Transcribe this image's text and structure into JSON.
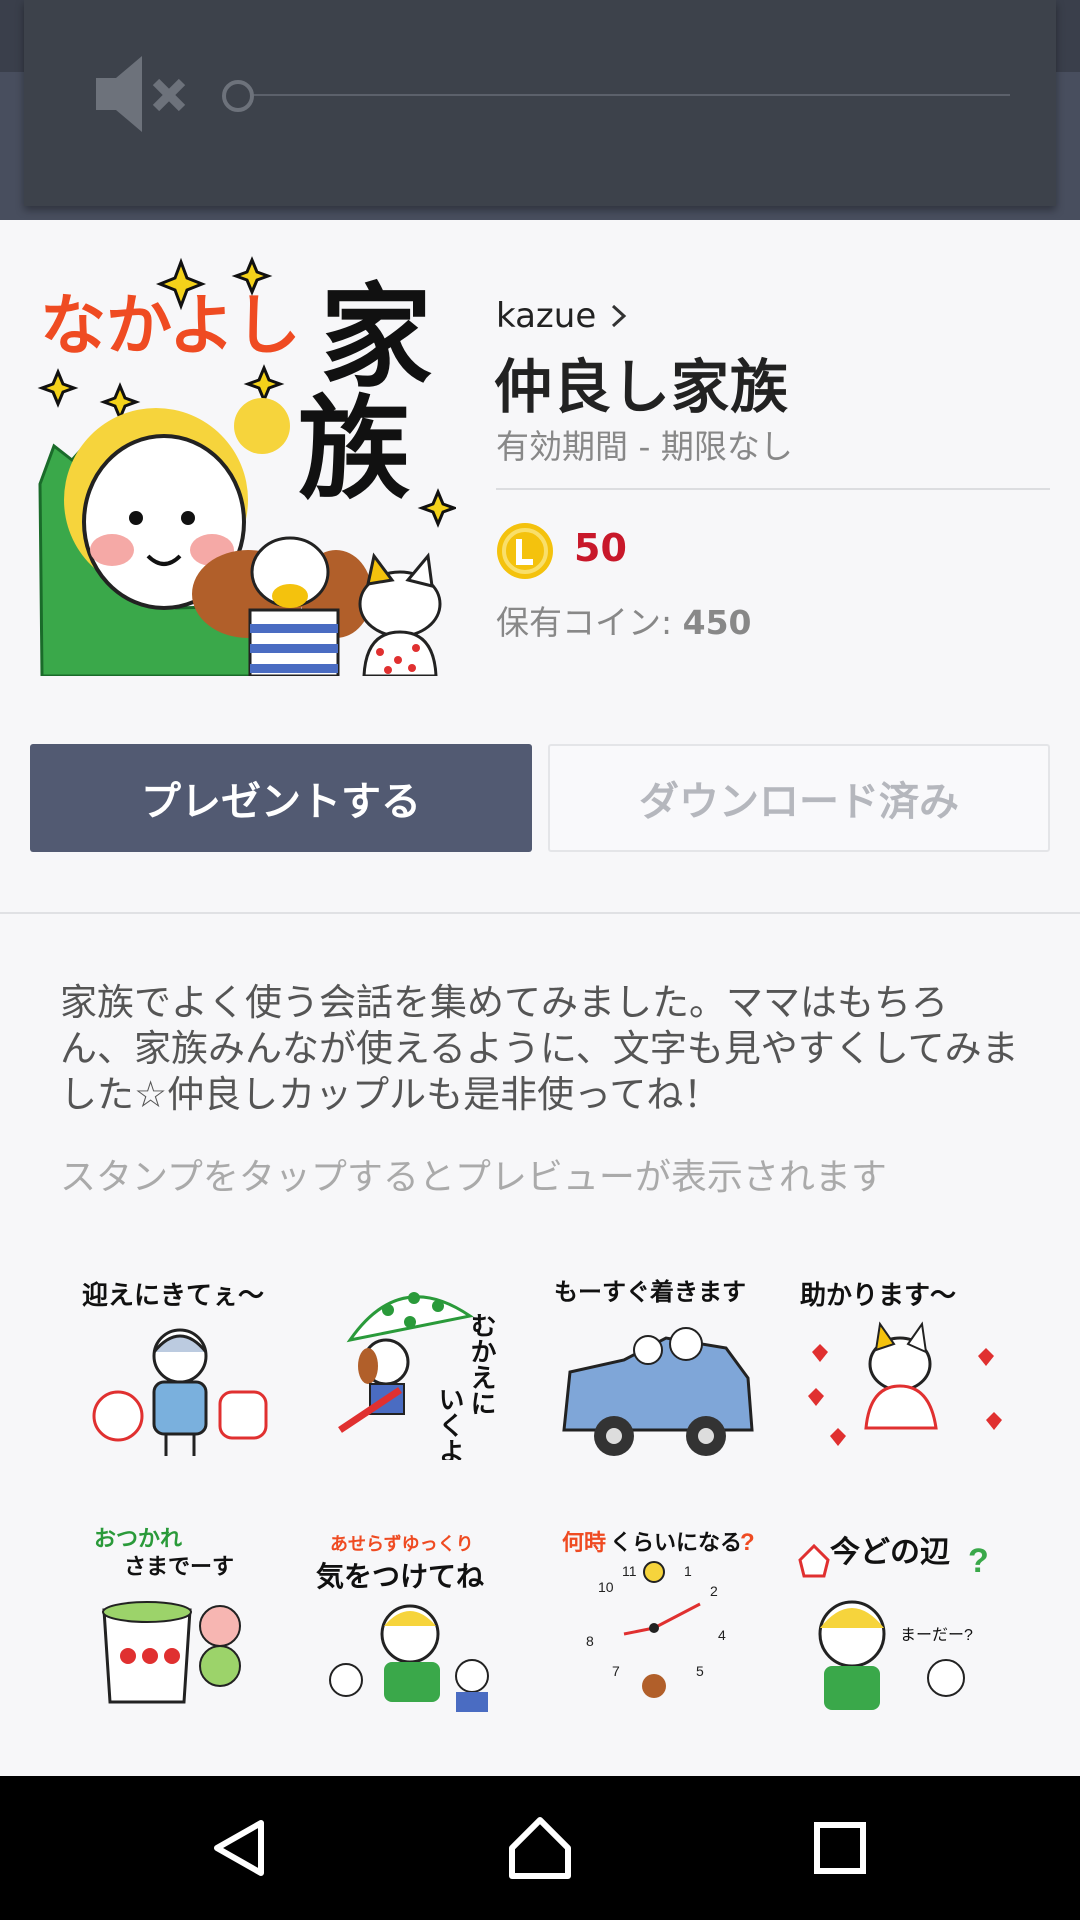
{
  "volume_panel": {
    "state": "muted",
    "level": 0
  },
  "product": {
    "author": "kazue",
    "title": "仲良し家族",
    "validity": "有効期間 - 期限なし",
    "price": "50",
    "owned_coins_label": "保有コイン: ",
    "owned_coins_value": "450",
    "sticker_art_text_1": "なかよし",
    "sticker_art_text_2": "家",
    "sticker_art_text_3": "族"
  },
  "buttons": {
    "present_label": "プレゼントする",
    "download_label": "ダウンロード済み"
  },
  "description": "家族でよく使う会話を集めてみました。ママはもちろん、家族みんなが使えるように、文字も見やすくしてみました☆仲良しカップルも是非使ってね！",
  "hint": "スタンプをタップするとプレビューが表示されます",
  "stickers": [
    {
      "text": "迎えにきてぇ〜",
      "icon": "sticker-mom-shopping"
    },
    {
      "text": "むかえにいくよ",
      "icon": "sticker-dog-umbrella"
    },
    {
      "text": "もーすぐ着きます",
      "icon": "sticker-family-car"
    },
    {
      "text": "助かります〜",
      "icon": "sticker-cat-hearts"
    },
    {
      "text": "おつかれさまでーす",
      "icon": "sticker-tea-cup"
    },
    {
      "text": "あせらずゆっくり気をつけてね",
      "icon": "sticker-mom-pets"
    },
    {
      "text": "何時くらいになる？",
      "icon": "sticker-clock"
    },
    {
      "text": "今どの辺？ まーだー？",
      "icon": "sticker-mom-cat-question"
    }
  ],
  "colors": {
    "accent": "#525a72",
    "price": "#c8182a",
    "coin": "#f4c20d"
  }
}
